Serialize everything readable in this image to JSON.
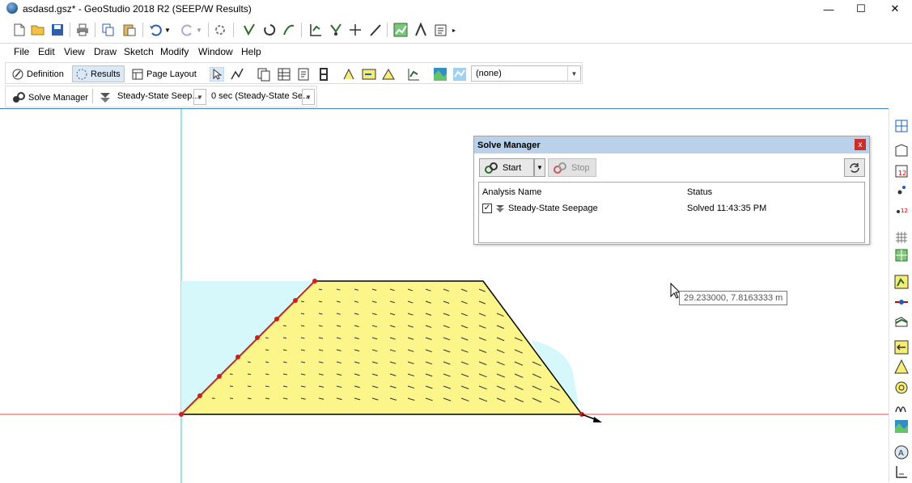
{
  "window": {
    "title": "asdasd.gsz* - GeoStudio 2018 R2 (SEEP/W Results)",
    "minimize_icon": "minimize-icon",
    "maximize_icon": "maximize-icon",
    "close_icon": "close-icon"
  },
  "toolbar_icons": [
    "new-file-icon",
    "open-folder-icon",
    "save-icon",
    "print-icon",
    "copy-icon",
    "paste-icon",
    "undo-icon",
    "redo-icon",
    "refresh-icon"
  ],
  "menu": {
    "items": [
      "File",
      "Edit",
      "View",
      "Draw",
      "Sketch",
      "Modify",
      "Window",
      "Help"
    ]
  },
  "modes": {
    "definition": "Definition",
    "results": "Results",
    "page_layout": "Page Layout",
    "view_select": "(none)"
  },
  "analysis_bar": {
    "solve_manager": "Solve Manager",
    "analysis_select": "Steady-State Seep...",
    "time_select": "0 sec (Steady-State Se..."
  },
  "solve_manager": {
    "title": "Solve Manager",
    "close": "x",
    "start_label": "Start",
    "stop_label": "Stop",
    "columns": [
      "Analysis Name",
      "Status"
    ],
    "rows": [
      {
        "checked": true,
        "name": "Steady-State Seepage",
        "status": "Solved 11:43:35 PM"
      }
    ]
  },
  "tooltip": {
    "coords": "29.233000, 7.8163333 m"
  },
  "colors": {
    "soil_fill": "#fbf58a",
    "seepage_zone": "#d6f8fb",
    "boundary_line": "#cc1f1f",
    "panel_header": "#b9d1ea"
  }
}
